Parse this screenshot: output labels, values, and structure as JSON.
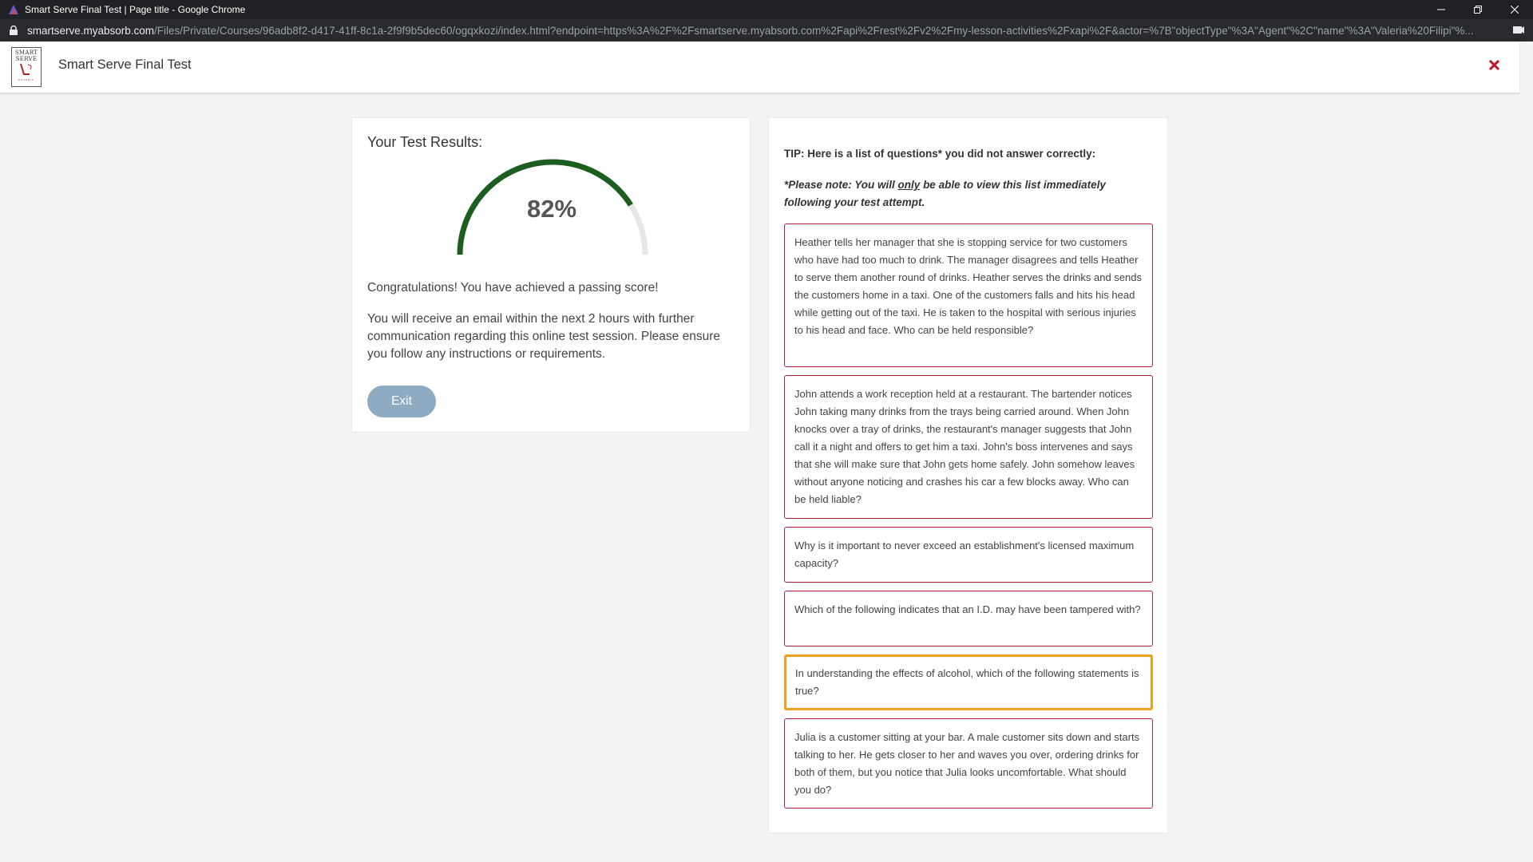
{
  "browser": {
    "window_title": "Smart Serve Final Test | Page title - Google Chrome",
    "url_domain": "smartserve.myabsorb.com",
    "url_rest": "/Files/Private/Courses/96adb8f2-d417-41ff-8c1a-2f9f9b5dec60/ogqxkozi/index.html?endpoint=https%3A%2F%2Fsmartserve.myabsorb.com%2Fapi%2Frest%2Fv2%2Fmy-lesson-activities%2Fxapi%2F&actor=%7B\"objectType\"%3A\"Agent\"%2C\"name\"%3A\"Valeria%20Filipi\"%..."
  },
  "header": {
    "logo_text": "SMART SERVE",
    "logo_subtext": "ONTARIO",
    "title": "Smart Serve Final Test"
  },
  "results": {
    "heading": "Your Test Results:",
    "score_percent": 82,
    "score_label": "82%",
    "congrats": "Congratulations! You have achieved a passing score!",
    "email_message": "You will receive an email within the next 2 hours with further communication regarding this online test session. Please ensure you follow any instructions or requirements.",
    "exit_label": "Exit",
    "gauge_color": "#1b5e20",
    "gauge_track_color": "#e6e6e6"
  },
  "tips": {
    "tip_text": "TIP: Here is a list of questions* you did not answer correctly:",
    "note_before": "*Please note: You will ",
    "note_emphasis": "only",
    "note_after": " be able to view this list immediately following your test attempt.",
    "questions": [
      "Heather tells her manager that she is stopping service for two customers who have had too much to drink. The manager disagrees and tells Heather to serve them another round of drinks. Heather serves the drinks and sends the customers home in a taxi. One of the customers falls and hits his head while getting out of the taxi. He is taken to the hospital with serious injuries to his head and face. Who can be held responsible?",
      "John attends a work reception held at a restaurant. The bartender notices John taking many drinks from the trays being carried around. When John knocks over a tray of drinks, the restaurant's manager suggests that John call it a night and offers to get him a taxi. John's boss intervenes and says that she will make sure that John gets home safely. John somehow leaves without anyone noticing and crashes his car a few blocks away. Who can be held liable?",
      "Why is it important to never exceed an establishment's licensed maximum capacity?",
      "Which of the following indicates that an I.D. may have been tampered with?",
      "In understanding the effects of alcohol, which of the following statements is true?",
      "Julia is a customer sitting at your bar. A male customer sits down and starts talking to her. He gets closer to her and waves you over, ordering drinks for both of them, but you notice that Julia looks uncomfortable. What should you do?"
    ],
    "focused_index": 4,
    "border_color": "#b5203a",
    "focus_color": "#f0a020"
  }
}
